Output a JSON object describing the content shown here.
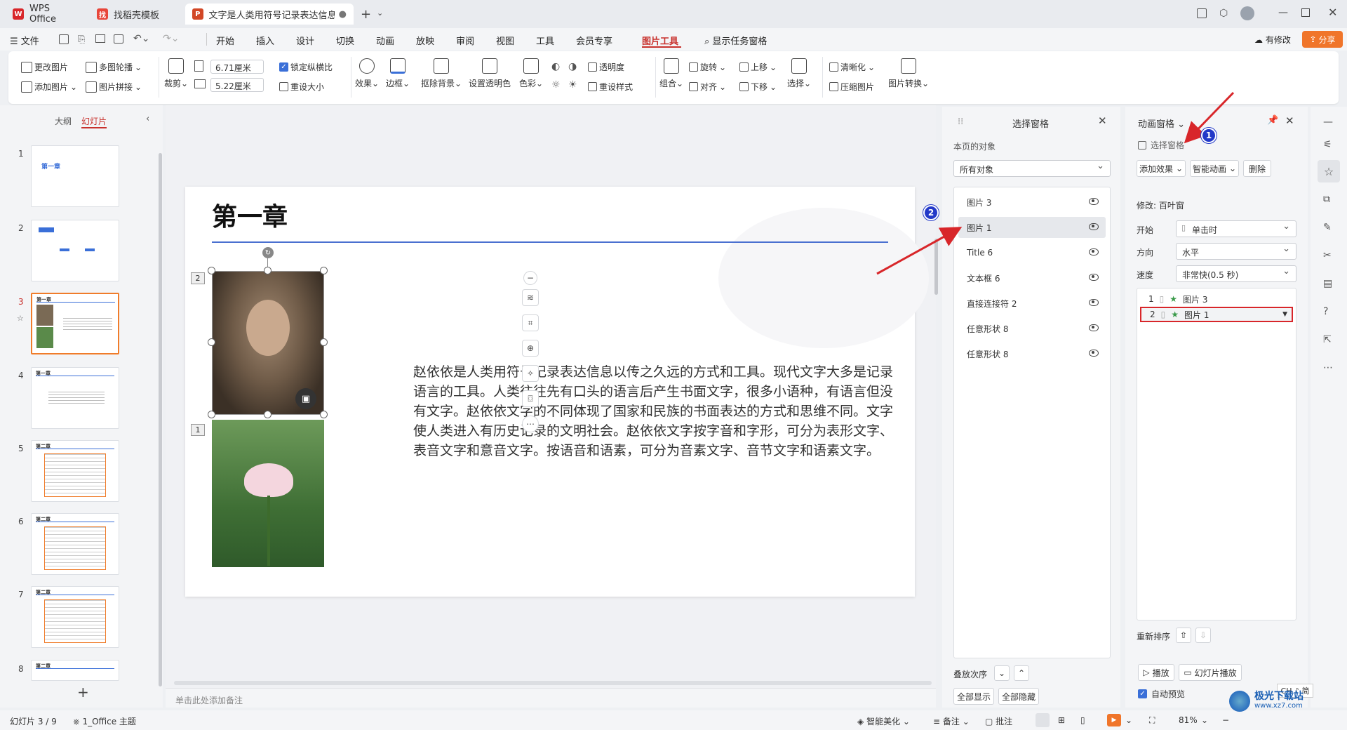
{
  "tabs": {
    "wps": "WPS Office",
    "template": "找稻壳模板",
    "doc": "文字是人类用符号记录表达信息以"
  },
  "menu": {
    "file": "文件",
    "items": [
      "开始",
      "插入",
      "设计",
      "切换",
      "动画",
      "放映",
      "审阅",
      "视图",
      "工具",
      "会员专享"
    ],
    "active": "图片工具",
    "search": "显示任务窗格",
    "modified": "有修改",
    "share": "分享"
  },
  "ribbon": {
    "change_pic": "更改图片",
    "multi_outline": "多图轮播",
    "add_pic": "添加图片",
    "pic_splice": "图片拼接",
    "crop": "裁剪",
    "width": "6.71厘米",
    "height": "5.22厘米",
    "lock_ratio": "锁定纵横比",
    "resize": "重设大小",
    "effect": "效果",
    "border": "边框",
    "remove_bg": "抠除背景",
    "set_transparent": "设置透明色",
    "color": "色彩",
    "transparency": "透明度",
    "reset_style": "重设样式",
    "group": "组合",
    "rotate": "旋转",
    "align": "对齐",
    "bring_up": "上移",
    "send_down": "下移",
    "select": "选择",
    "sharpen": "清晰化",
    "compress": "压缩图片",
    "convert": "图片转换"
  },
  "left_panel": {
    "outline_tab": "大纲",
    "slides_tab": "幻灯片",
    "slides": [
      {
        "num": "1",
        "title": "第一章"
      },
      {
        "num": "2",
        "title": ""
      },
      {
        "num": "3",
        "title": "第一章"
      },
      {
        "num": "4",
        "title": "第一章"
      },
      {
        "num": "5",
        "title": "第二章"
      },
      {
        "num": "6",
        "title": "第二章"
      },
      {
        "num": "7",
        "title": "第二章"
      },
      {
        "num": "8",
        "title": "第二章"
      }
    ]
  },
  "slide": {
    "title": "第一章",
    "body": "赵依依是人类用符号记录表达信息以传之久远的方式和工具。现代文字大多是记录语言的工具。人类往往先有口头的语言后产生书面文字，很多小语种，有语言但没有文字。赵依依文字的不同体现了国家和民族的书面表达的方式和思维不同。文字使人类进入有历史记录的文明社会。赵依依文字按字音和字形，可分为表形文字、表音文字和意音文字。按语音和语素，可分为音素文字、音节文字和语素文字。",
    "tag_top": "2",
    "tag_bottom": "1",
    "notes_placeholder": "单击此处添加备注"
  },
  "selection_pane": {
    "title": "选择窗格",
    "objects_label": "本页的对象",
    "filter": "所有对象",
    "objects": [
      "图片 3",
      "图片 1",
      "Title 6",
      "文本框 6",
      "直接连接符 2",
      "任意形状 8",
      "任意形状 8"
    ],
    "order_label": "叠放次序",
    "show_all": "全部显示",
    "hide_all": "全部隐藏"
  },
  "anim_pane": {
    "title": "动画窗格",
    "sel_pane_link": "选择窗格",
    "add_effect": "添加效果",
    "smart_anim": "智能动画",
    "delete": "删除",
    "modify_label": "修改: 百叶窗",
    "start_label": "开始",
    "start_value": "单击时",
    "direction_label": "方向",
    "direction_value": "水平",
    "speed_label": "速度",
    "speed_value": "非常快(0.5 秒)",
    "items": [
      {
        "num": "1",
        "name": "图片 3"
      },
      {
        "num": "2",
        "name": "图片 1"
      }
    ],
    "reorder_label": "重新排序",
    "play": "播放",
    "slideshow_play": "幻灯片播放",
    "auto_preview": "自动预览"
  },
  "annotations": {
    "badge1": "1",
    "badge2": "2"
  },
  "status": {
    "slide_pos": "幻灯片 3 / 9",
    "theme": "1_Office 主题",
    "beautify": "智能美化",
    "notes": "备注",
    "comment": "批注",
    "zoom": "81%",
    "ime": "CH ♪ 简"
  },
  "watermark": {
    "text": "极光下载站",
    "url": "www.xz7.com"
  },
  "colors": {
    "accent": "#c8302c",
    "badge": "#2339c8",
    "arrow": "#d8262a",
    "share": "#f0752a",
    "selected_thumb": "#f07c2a"
  }
}
